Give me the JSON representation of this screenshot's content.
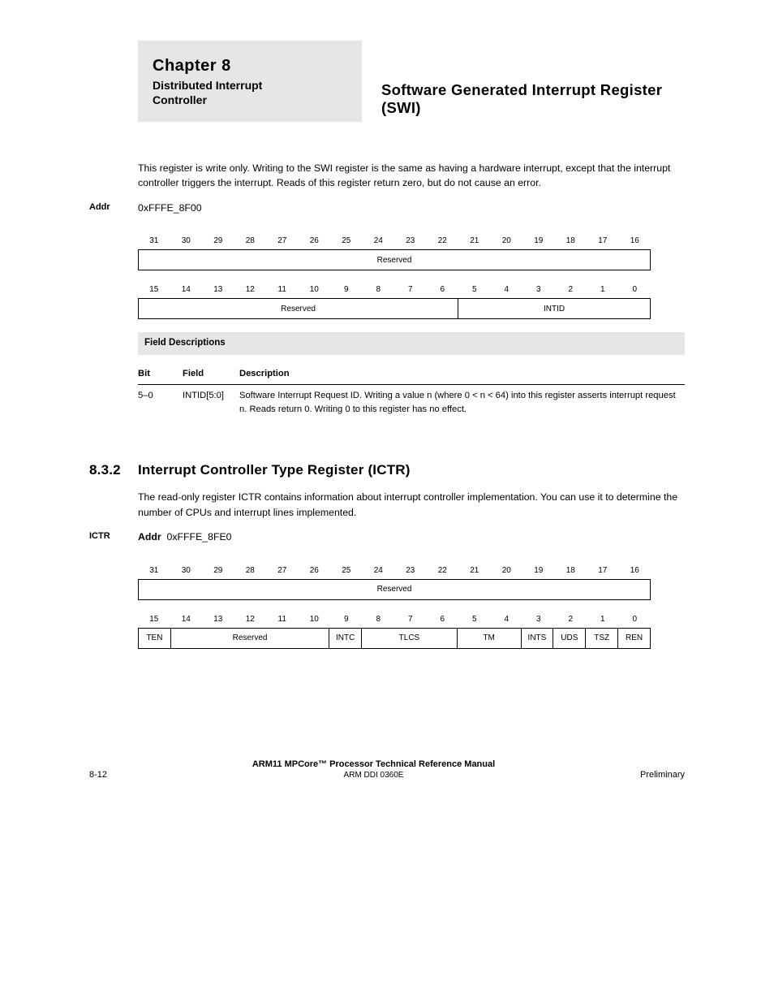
{
  "header": {
    "chapter_line1": "Chapter 8",
    "chapter_line2": "Distributed Interrupt",
    "chapter_line3": "Controller",
    "caption": "Software Generated Interrupt Register (SWI)"
  },
  "intro_p1": "This register is write only. Writing to the SWI register is the same as having a hardware interrupt, except that the interrupt controller triggers the interrupt. Reads of this register return zero, but do not cause an error.",
  "swi_addr_label": "Addr",
  "swi_addr_value": "0xFFFE_8F00",
  "bits_hi": [
    "31",
    "30",
    "29",
    "28",
    "27",
    "26",
    "25",
    "24",
    "23",
    "22",
    "21",
    "20",
    "19",
    "18",
    "17",
    "16"
  ],
  "bits_lo": [
    "15",
    "14",
    "13",
    "12",
    "11",
    "10",
    "9",
    "8",
    "7",
    "6",
    "5",
    "4",
    "3",
    "2",
    "1",
    "0"
  ],
  "reserved": "Reserved",
  "intid": "INTID",
  "field_table_title": "Field Descriptions",
  "ft_head_bit": "Bit",
  "ft_head_field": "Field",
  "ft_head_desc": "Description",
  "swi_row_bit": "5–0",
  "swi_row_field": "INTID[5:0]",
  "swi_row_desc": "Software Interrupt Request ID. Writing a value n (where 0 < n < 64) into this register asserts interrupt request n. Reads return 0. Writing 0 to this register has no effect.",
  "sec8_num": "8.3.2",
  "sec8_title": "Interrupt Controller Type Register (ICTR)",
  "ictr_p1": "The read-only register ICTR contains information about interrupt controller implementation. You can use it to determine the number of CPUs and interrupt lines implemented.",
  "ictr_gutter": "ICTR",
  "ictr_addr_label": "Addr",
  "ictr_addr_value": "0xFFFE_8FE0",
  "ictr_fields": {
    "ten": "TEN",
    "reserved2": "Reserved",
    "intc": "INTC",
    "tlcs": "TLCS",
    "tm": "TM",
    "ints": "INTS",
    "uds": "UDS",
    "tsz": "TSZ",
    "ren": "REN"
  },
  "footer": {
    "left": "8-12",
    "mid1": "ARM11 MPCore™ Processor Technical Reference Manual",
    "mid2": "ARM DDI 0360E",
    "right": "Preliminary"
  }
}
